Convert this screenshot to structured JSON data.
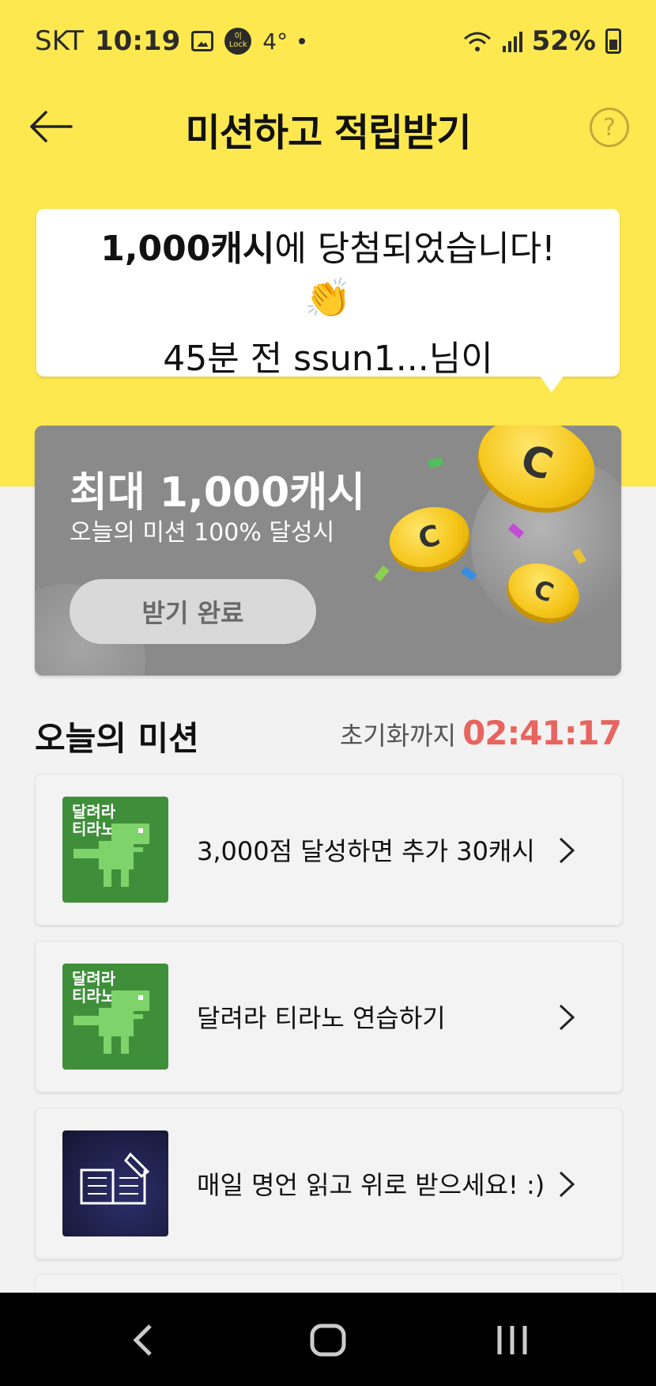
{
  "status_bar": {
    "carrier": "SKT",
    "time": "10:19",
    "lock_badge": "이\nLock",
    "temperature": "4°",
    "battery": "52%"
  },
  "header": {
    "title": "미션하고 적립받기",
    "help": "?"
  },
  "winner_bubble": {
    "line1_bold": "1,000캐시",
    "line1_rest": "에 당첨되었습니다!",
    "emoji": "👏",
    "line2": "45분 전 ssun1...님이"
  },
  "promo": {
    "title": "최대 1,000캐시",
    "subtitle": "오늘의 미션 100% 달성시",
    "button_label": "받기 완료",
    "coin_letter": "C"
  },
  "missions_section": {
    "title": "오늘의 미션",
    "reset_label": "초기화까지",
    "reset_timer": "02:41:17"
  },
  "missions": [
    {
      "thumb_text": "달려라\n티라노",
      "label": "3,000점 달성하면 추가 30캐시"
    },
    {
      "thumb_text": "달려라\n티라노",
      "label": "달려라 티라노 연습하기"
    },
    {
      "thumb_text": "",
      "label": "매일 명언 읽고 위로 받으세요! :)"
    }
  ],
  "colors": {
    "brand_yellow": "#fde94f",
    "timer_red": "#e8645e",
    "promo_gray": "#8a8a8a"
  }
}
